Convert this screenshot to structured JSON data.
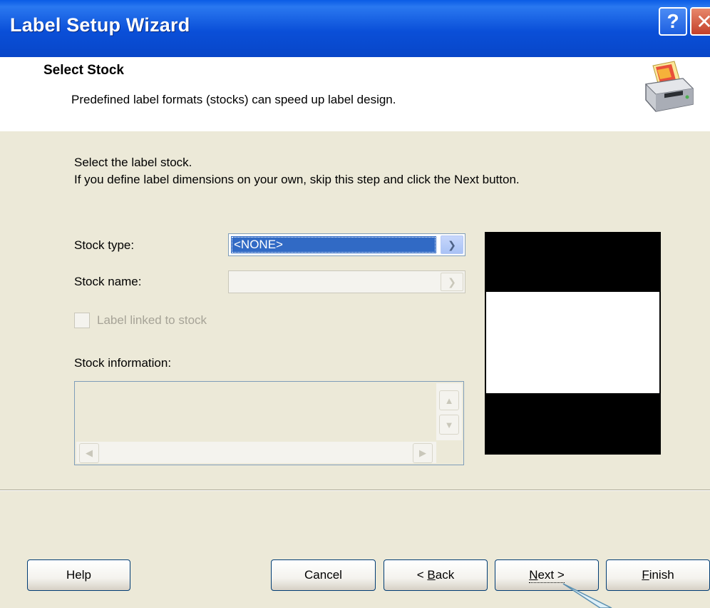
{
  "window": {
    "title": "Label Setup Wizard",
    "help_glyph": "?",
    "close_glyph": "✕"
  },
  "header": {
    "title": "Select Stock",
    "subtitle": "Predefined label formats (stocks) can speed up label design.",
    "icon": "printer-icon"
  },
  "body": {
    "intro_line1": "Select the label stock.",
    "intro_line2": "If you define label dimensions on your own, skip this step and click the Next button.",
    "stock_type_label": "Stock type:",
    "stock_type_value": "<NONE>",
    "stock_name_label": "Stock name:",
    "stock_name_value": "",
    "linked_checkbox_label": "Label linked to stock",
    "linked_checked": false,
    "stock_info_label": "Stock information:",
    "stock_info_text": ""
  },
  "buttons": {
    "help": "Help",
    "cancel": "Cancel",
    "back_prefix": "< ",
    "back_u": "B",
    "back_rest": "ack",
    "next_u": "N",
    "next_rest": "ext >",
    "finish_u": "F",
    "finish_rest": "inish"
  },
  "colors": {
    "titlebar": "#0a4fd8",
    "selection": "#316ac5",
    "dialog_bg": "#ece9d8"
  }
}
